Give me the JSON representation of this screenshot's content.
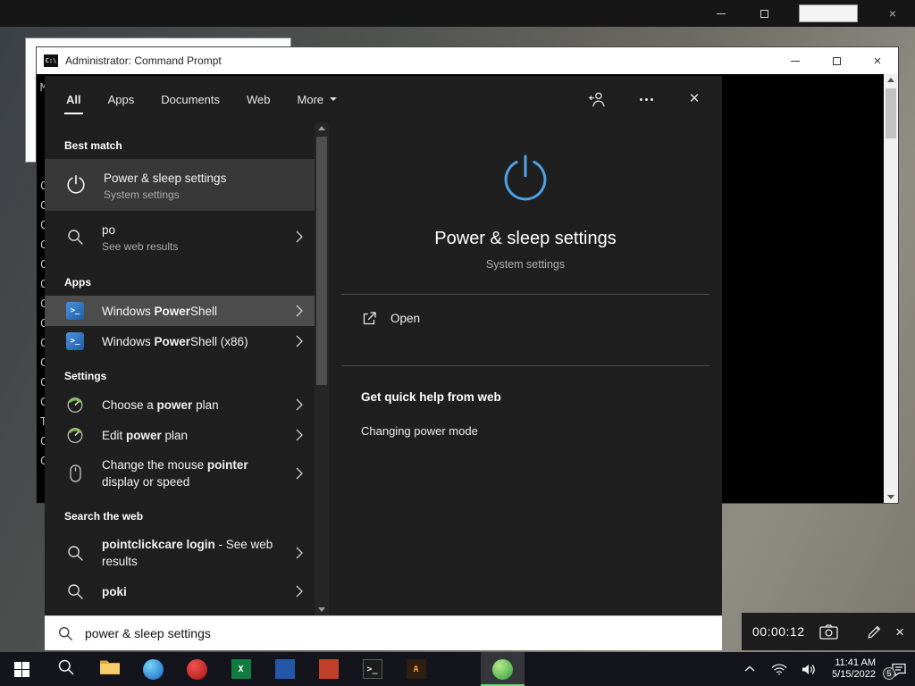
{
  "colors": {
    "accent": "#4da3e8",
    "taskbar-active": "#6fd574",
    "panel_bg": "#1f1f1f",
    "best_match_bg": "#383838",
    "selected_row_bg": "#4d4d4d"
  },
  "icons": {
    "user-account": "person-with-arrow",
    "more-options": "ellipsis",
    "close": "×",
    "chevron-right": "›",
    "power": "power-symbol",
    "search": "magnifier",
    "open": "box-with-arrow",
    "camera": "camera",
    "edit": "pencil",
    "windows-logo": "four-panes"
  },
  "background_window": {
    "close_icon": "×"
  },
  "cmd_window": {
    "title": "Administrator: Command Prompt",
    "icon_glyph": "C:\\",
    "close_icon": "×",
    "console_fragments": [
      "M",
      "",
      "",
      "",
      "",
      "C",
      "C",
      "C",
      "C",
      "C",
      "C",
      "C",
      "C",
      "C",
      "C",
      "C",
      "C",
      "T",
      "C",
      "C"
    ]
  },
  "search": {
    "tabs": [
      {
        "label": "All",
        "active": true
      },
      {
        "label": "Apps"
      },
      {
        "label": "Documents"
      },
      {
        "label": "Web"
      },
      {
        "label": "More",
        "dropdown": true
      }
    ],
    "sections": [
      {
        "header": "Best match",
        "items": [
          {
            "icon": "power",
            "segments": [
              {
                "text": "Power & sleep settings"
              }
            ],
            "subtitle": "System settings",
            "style": "best",
            "chevron": false
          }
        ]
      },
      {
        "header": "",
        "items": [
          {
            "icon": "search",
            "segments": [
              {
                "text": "po"
              }
            ],
            "subtitle": "See web results",
            "chevron": true
          }
        ]
      },
      {
        "header": "Apps",
        "items": [
          {
            "icon": "powershell",
            "segments": [
              {
                "text": "Windows "
              },
              {
                "text": "Power",
                "bold": true
              },
              {
                "text": "Shell"
              }
            ],
            "chevron": true,
            "selected": true
          },
          {
            "icon": "powershell",
            "segments": [
              {
                "text": "Windows "
              },
              {
                "text": "Power",
                "bold": true
              },
              {
                "text": "Shell (x86)"
              }
            ],
            "chevron": true
          }
        ]
      },
      {
        "header": "Settings",
        "items": [
          {
            "icon": "powerplan",
            "segments": [
              {
                "text": "Choose a "
              },
              {
                "text": "power",
                "bold": true
              },
              {
                "text": " plan"
              }
            ],
            "chevron": true
          },
          {
            "icon": "powerplan",
            "segments": [
              {
                "text": "Edit "
              },
              {
                "text": "power",
                "bold": true
              },
              {
                "text": " plan"
              }
            ],
            "chevron": true
          },
          {
            "icon": "mouse",
            "segments": [
              {
                "text": "Change the mouse "
              },
              {
                "text": "pointer",
                "bold": true
              },
              {
                "text": " display or speed"
              }
            ],
            "chevron": true
          }
        ]
      },
      {
        "header": "Search the web",
        "items": [
          {
            "icon": "search",
            "segments": [
              {
                "text": "pointclickcare login",
                "bold": true
              },
              {
                "text": " - See web results"
              }
            ],
            "chevron": true
          },
          {
            "icon": "search",
            "segments": [
              {
                "text": "poki",
                "bold": true
              }
            ],
            "chevron": true
          }
        ]
      }
    ],
    "preview": {
      "title": "Power & sleep settings",
      "subtitle": "System settings",
      "open_label": "Open",
      "help_header": "Get quick help from web",
      "help_links": [
        "Changing power mode"
      ]
    },
    "search_box": {
      "value": "power & sleep settings"
    }
  },
  "recorder": {
    "time": "00:00:12"
  },
  "taskbar": {
    "apps": [
      {
        "name": "start",
        "kind": "start"
      },
      {
        "name": "search",
        "kind": "search"
      },
      {
        "name": "file-explorer",
        "kind": "folder"
      },
      {
        "name": "browser",
        "kind": "circle",
        "c1": "#7ad4f4",
        "c2": "#1565c9"
      },
      {
        "name": "red-circle-app",
        "kind": "circle",
        "c1": "#ef5350",
        "c2": "#a91318"
      },
      {
        "name": "excel",
        "kind": "tile",
        "bg": "#107c41",
        "fg": "#ffffff",
        "glyph": "X"
      },
      {
        "name": "blue-tile-app",
        "kind": "tile",
        "bg": "#2457a8",
        "fg": "#ffffff",
        "glyph": ""
      },
      {
        "name": "orange-tile-app",
        "kind": "tile",
        "bg": "#c2402a",
        "fg": "#ffffff",
        "glyph": ""
      },
      {
        "name": "command-prompt",
        "kind": "tile",
        "bg": "#1c1c1c",
        "fg": "#e8e8e8",
        "glyph": ">_",
        "border": "#5a5a5a"
      },
      {
        "name": "a-letter-app",
        "kind": "tile",
        "bg": "#2e1f10",
        "fg": "#f5a02c",
        "glyph": "A"
      },
      {
        "name": "screen-recorder",
        "kind": "circle",
        "c1": "#b8e986",
        "c2": "#2f9e44",
        "active": true,
        "gap_before": true
      }
    ],
    "tray": {
      "time": "11:41 AM",
      "date": "5/15/2022",
      "badge": "5"
    }
  }
}
